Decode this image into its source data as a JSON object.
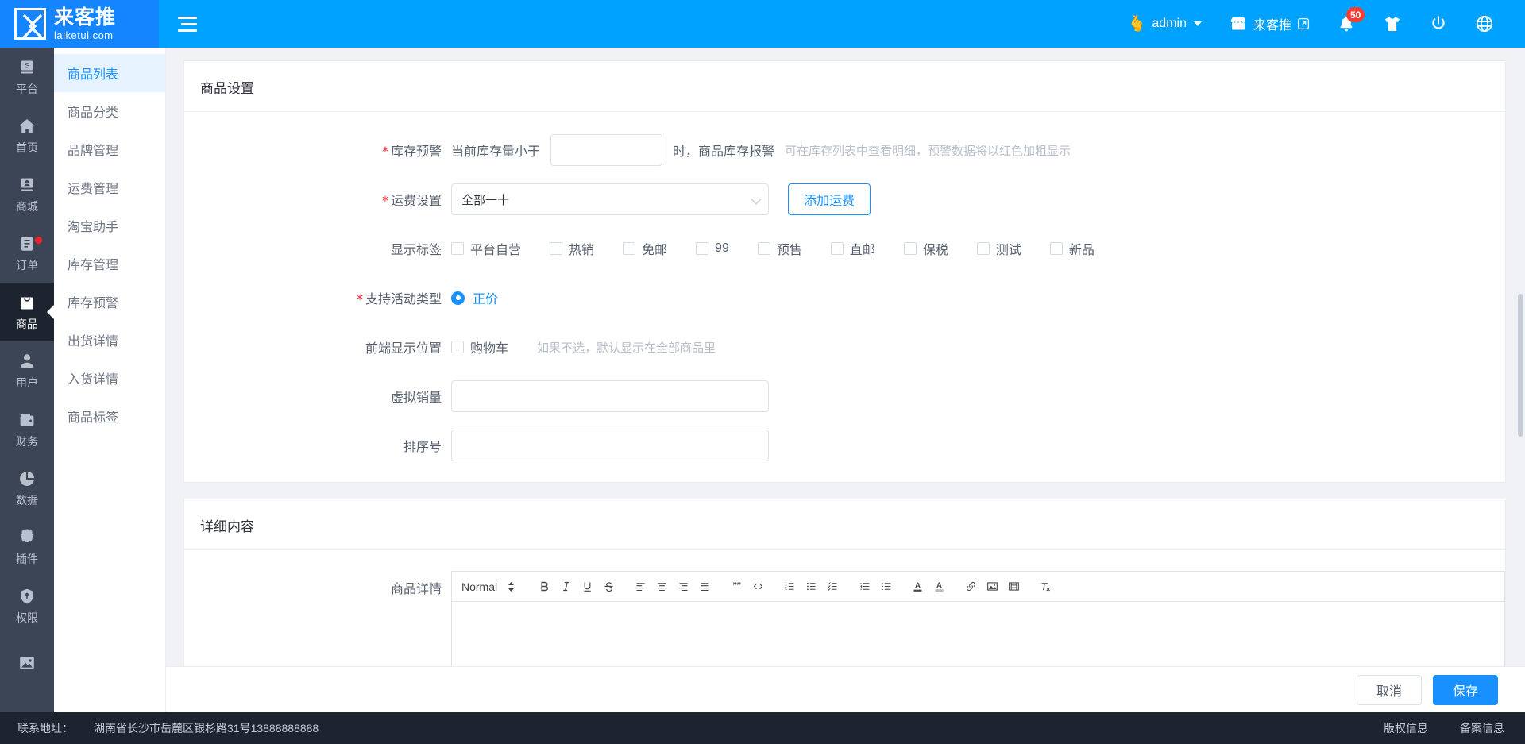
{
  "header": {
    "logo_cn": "来客推",
    "logo_en": "laiketui.com",
    "menu_toggle_name": "menu-toggle",
    "user": {
      "emoji": "🫰",
      "name": "admin"
    },
    "shop": {
      "label": "来客推"
    },
    "notifications": {
      "count": "50"
    },
    "colors": {
      "bar": "#00a2ff",
      "logo_bg": "#1484ff",
      "badge": "#ff3b30"
    }
  },
  "rail": {
    "items": [
      {
        "label": "平台",
        "icon": "platform-icon",
        "active": false,
        "dot": false
      },
      {
        "label": "首页",
        "icon": "home-icon",
        "active": false,
        "dot": false
      },
      {
        "label": "商城",
        "icon": "mall-icon",
        "active": false,
        "dot": false
      },
      {
        "label": "订单",
        "icon": "order-icon",
        "active": false,
        "dot": true
      },
      {
        "label": "商品",
        "icon": "goods-icon",
        "active": true,
        "dot": false
      },
      {
        "label": "用户",
        "icon": "user-icon",
        "active": false,
        "dot": false
      },
      {
        "label": "财务",
        "icon": "finance-icon",
        "active": false,
        "dot": false
      },
      {
        "label": "数据",
        "icon": "data-icon",
        "active": false,
        "dot": false
      },
      {
        "label": "插件",
        "icon": "plugin-icon",
        "active": false,
        "dot": false
      },
      {
        "label": "权限",
        "icon": "permission-icon",
        "active": false,
        "dot": false
      },
      {
        "label": "",
        "icon": "image-icon",
        "active": false,
        "dot": false
      }
    ]
  },
  "submenu": {
    "items": [
      {
        "label": "商品列表",
        "active": true
      },
      {
        "label": "商品分类",
        "active": false
      },
      {
        "label": "品牌管理",
        "active": false
      },
      {
        "label": "运费管理",
        "active": false
      },
      {
        "label": "淘宝助手",
        "active": false
      },
      {
        "label": "库存管理",
        "active": false
      },
      {
        "label": "库存预警",
        "active": false
      },
      {
        "label": "出货详情",
        "active": false
      },
      {
        "label": "入货详情",
        "active": false
      },
      {
        "label": "商品标签",
        "active": false
      }
    ]
  },
  "product_settings": {
    "title": "商品设置",
    "stock_warning": {
      "label": "库存预警",
      "required": true,
      "prefix": "当前库存量小于",
      "value": "",
      "placeholder": "",
      "suffix": "时，商品库存报警",
      "hint": "可在库存列表中查看明细，预警数据将以红色加粗显示"
    },
    "freight": {
      "label": "运费设置",
      "required": true,
      "value": "全部一十",
      "add_button": "添加运费"
    },
    "display_tags": {
      "label": "显示标签",
      "options": [
        {
          "label": "平台自营",
          "checked": false
        },
        {
          "label": "热销",
          "checked": false
        },
        {
          "label": "免邮",
          "checked": false
        },
        {
          "label": "99",
          "checked": false
        },
        {
          "label": "预售",
          "checked": false
        },
        {
          "label": "直邮",
          "checked": false
        },
        {
          "label": "保税",
          "checked": false
        },
        {
          "label": "测试",
          "checked": false
        },
        {
          "label": "新品",
          "checked": false
        }
      ]
    },
    "activity_type": {
      "label": "支持活动类型",
      "required": true,
      "options": [
        {
          "label": "正价",
          "checked": true
        }
      ]
    },
    "front_position": {
      "label": "前端显示位置",
      "options": [
        {
          "label": "购物车",
          "checked": false
        }
      ],
      "hint": "如果不选，默认显示在全部商品里"
    },
    "virtual_sales": {
      "label": "虚拟销量",
      "value": "",
      "placeholder": ""
    },
    "sort_number": {
      "label": "排序号",
      "value": "",
      "placeholder": ""
    }
  },
  "detail_content": {
    "title": "详细内容",
    "editor_label": "商品详情",
    "toolbar": {
      "format_picker": "Normal",
      "buttons": [
        "bold-icon",
        "italic-icon",
        "underline-icon",
        "strikethrough-icon",
        "align-left-icon",
        "align-center-icon",
        "align-right-icon",
        "align-justify-icon",
        "blockquote-icon",
        "code-block-icon",
        "ordered-list-icon",
        "bullet-list-icon",
        "check-list-icon",
        "outdent-icon",
        "indent-icon",
        "font-color-icon",
        "background-color-icon",
        "link-icon",
        "image-icon",
        "video-icon",
        "clear-format-icon"
      ]
    },
    "content": ""
  },
  "actions": {
    "cancel": "取消",
    "save": "保存"
  },
  "footer": {
    "address_label": "联系地址：",
    "address_value": "湖南省长沙市岳麓区银杉路31号13888888888",
    "links": [
      "版权信息",
      "备案信息"
    ]
  }
}
